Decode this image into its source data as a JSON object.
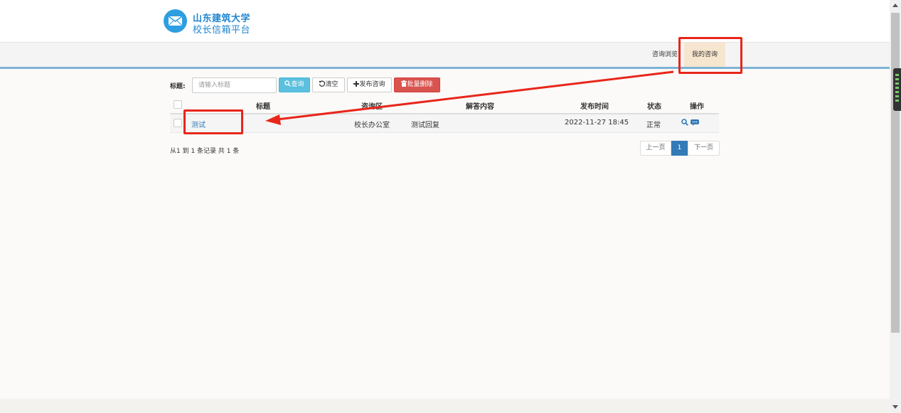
{
  "brand": {
    "line1": "山东建筑大学",
    "line2": "校长信箱平台",
    "logo_icon": "envelope-icon",
    "color": "#1e86d0"
  },
  "nav": {
    "browse": "咨询浏览",
    "mine": "我的咨询"
  },
  "search": {
    "label": "标题:",
    "placeholder": "请输入标题",
    "value": ""
  },
  "toolbar": {
    "query": "查询",
    "clear": "清空",
    "publish": "发布咨询",
    "batch_delete": "批量删除"
  },
  "table": {
    "columns": [
      "标题",
      "咨询区",
      "解答内容",
      "发布时间",
      "状态",
      "操作"
    ],
    "rows": [
      {
        "title": "测试",
        "area": "校长办公室",
        "answer": "测试回复",
        "time": "2022-11-27 18:45",
        "status": "正常",
        "actions": [
          "search-icon",
          "comment-icon"
        ]
      }
    ]
  },
  "pagination": {
    "summary": "从1 到 1 条记录 共 1 条",
    "prev": "上一页",
    "current": "1",
    "next": "下一页"
  },
  "colors": {
    "accent": "#337ab7",
    "info": "#5bc0de",
    "danger": "#d9534f",
    "highlight": "#e8261a",
    "active_nav": "#f7e6cf"
  }
}
